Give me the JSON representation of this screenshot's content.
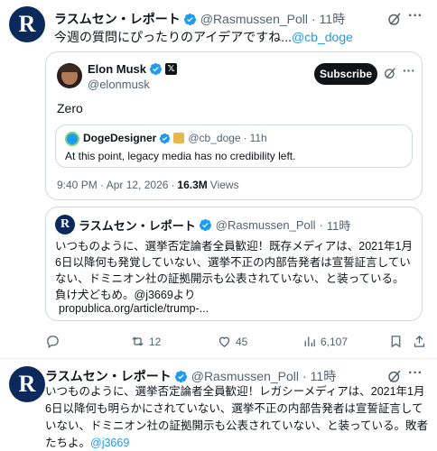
{
  "tweet1": {
    "name": "ラスムセン・レポート",
    "handle": "@Rasmussen_Poll",
    "time": "11時",
    "text": "今週の質問にぴったりのアイデアですね...",
    "mention": "@cb_doge",
    "avatar_letter": "R",
    "quote": {
      "name": "Elon Musk",
      "handle": "@elonmusk",
      "subscribe_label": "Subscribe",
      "text": "Zero",
      "inner_quote": {
        "name": "DogeDesigner",
        "handle": "@cb_doge",
        "time": "11h",
        "text": "At this point, legacy media has no credibility left."
      },
      "timestamp": "9:40 PM · Apr 12, 2026",
      "views_count": "16.3M",
      "views_label": "Views"
    },
    "quote2": {
      "name": "ラスムセン・レポート",
      "handle": "@Rasmussen_Poll",
      "time": "11時",
      "text": "いつものように、選挙否定論者全員歓迎！既存メディアは、2021年1月6日以降何も発覚していない、選挙不正の内部告発者は宣誓証言していない、ドミニオン社の証拠開示も公表されていない、と装っている。負け犬どもめ。@j3669より",
      "link": "propublica.org/article/trump-..."
    },
    "actions": {
      "reply": "",
      "retweet": "12",
      "like": "45",
      "views": "6,107"
    }
  },
  "tweet2": {
    "name": "ラスムセン・レポート",
    "handle": "@Rasmussen_Poll",
    "time": "11時",
    "text": "いつものように、選挙否定論者全員歓迎！レガシーメディアは、2021年1月6日以降何も明らかにされていない、選挙不正の内部告発者は宣誓証言していない、ドミニオン社の証拠開示も公表されていない、と装っている。敗者たちよ。",
    "mention": "@j3669",
    "avatar_letter": "R"
  },
  "colors": {
    "accent": "#1d9bf0",
    "secondary_text": "#536471",
    "border": "#cfd9de",
    "avatar_bg": "#0b2a5b"
  }
}
